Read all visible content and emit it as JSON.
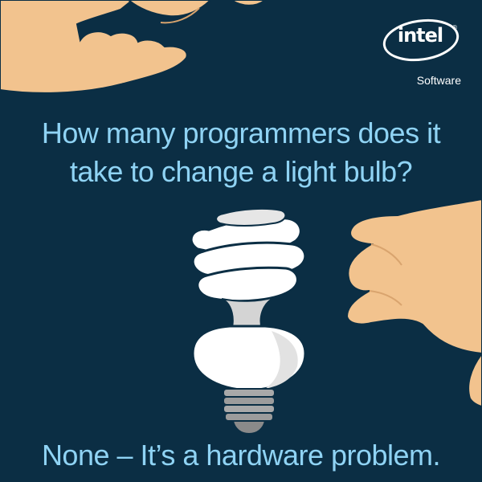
{
  "brand": {
    "wordmark": "intel",
    "trademark": "®",
    "division": "Software"
  },
  "joke": {
    "question_line_1": "How many programmers does it",
    "question_line_2": "take to change a light bulb?",
    "answer": "None – It’s a hardware problem."
  },
  "colors": {
    "background": "#0b2e44",
    "text": "#8fd3f4",
    "skin": "#f2c38e",
    "bulb": "#ffffff"
  },
  "icons": [
    "hand-top-icon",
    "hand-right-icon",
    "light-bulb-icon",
    "intel-logo-icon"
  ]
}
